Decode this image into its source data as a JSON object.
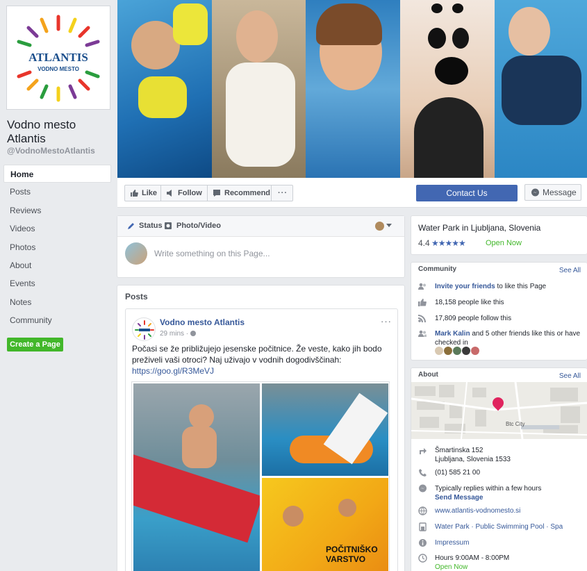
{
  "page": {
    "name": "Vodno mesto Atlantis",
    "handle": "@VodnoMestoAtlantis",
    "logo_text": "ATLANTIS",
    "logo_sub": "VODNO MESTO"
  },
  "nav": {
    "items": [
      {
        "label": "Home",
        "active": true
      },
      {
        "label": "Posts"
      },
      {
        "label": "Reviews"
      },
      {
        "label": "Videos"
      },
      {
        "label": "Photos"
      },
      {
        "label": "About"
      },
      {
        "label": "Events"
      },
      {
        "label": "Notes"
      },
      {
        "label": "Community"
      }
    ],
    "create_page": "Create a Page"
  },
  "actions": {
    "like": "Like",
    "follow": "Follow",
    "recommend": "Recommend",
    "more": "···",
    "contact": "Contact Us",
    "message": "Message"
  },
  "composer": {
    "status": "Status",
    "photo_video": "Photo/Video",
    "placeholder": "Write something on this Page..."
  },
  "posts": {
    "title": "Posts",
    "post": {
      "author": "Vodno mesto Atlantis",
      "time": "29 mins · ",
      "more": "···",
      "text": "Počasi se že približujejo jesenske počitnice. Že veste, kako jih bodo preživeli vaši otroci? Naj uživajo v vodnih dogodivščinah:",
      "link": "https://goo.gl/R3MeVJ",
      "image_caption_1": "POČITNIŠKO",
      "image_caption_2": "VARSTVO"
    }
  },
  "right": {
    "category": "Water Park in Ljubljana, Slovenia",
    "rating": "4.4",
    "stars": "★★★★★",
    "open_now": "Open Now",
    "community": {
      "title": "Community",
      "see_all": "See All",
      "invite_link": "Invite your friends",
      "invite_rest": " to like this Page",
      "likes": "18,158 people like this",
      "follows": "17,809 people follow this",
      "friend_name": "Mark Kalin",
      "friend_rest": " and 5 other friends like this or have checked in"
    },
    "about": {
      "title": "About",
      "see_all": "See All",
      "map_label": "Btc City",
      "address_line1": "Šmartinska 152",
      "address_line2": "Ljubljana, Slovenia 1533",
      "phone": "(01) 585 21 00",
      "reply_text": "Typically replies within a few hours",
      "send_message": "Send Message",
      "website": "www.atlantis-vodnomesto.si",
      "categories": "Water Park · Public Swimming Pool · Spa",
      "impressum": "Impressum",
      "hours": "Hours 9:00AM - 8:00PM",
      "hours_open": "Open Now"
    }
  },
  "colors": {
    "fb_blue": "#4267b2",
    "link_blue": "#365899",
    "green": "#42b72a",
    "background": "#e9ebee"
  }
}
